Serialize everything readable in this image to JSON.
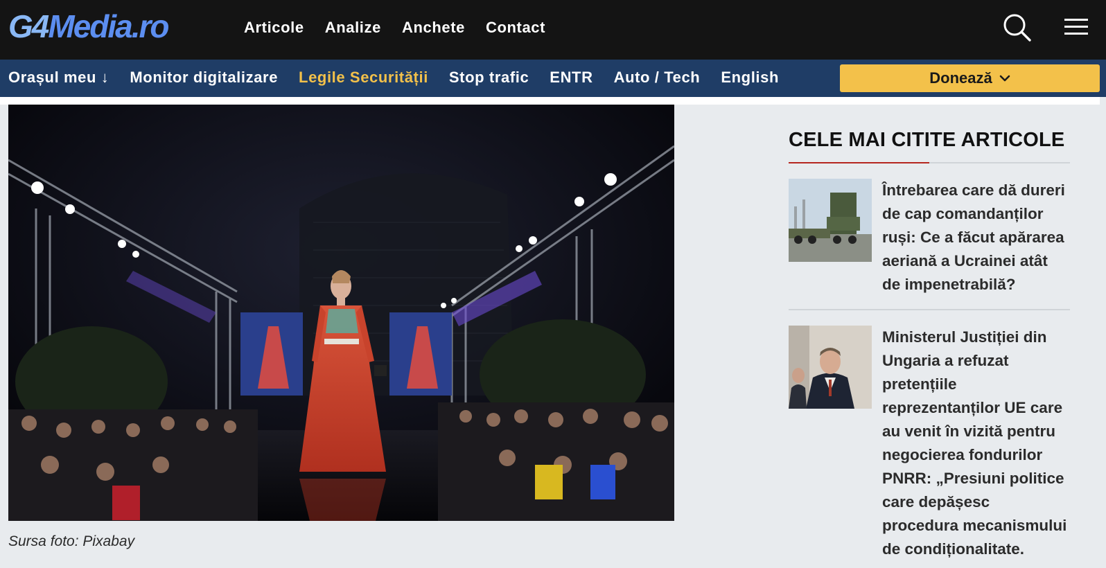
{
  "header": {
    "logo_prefix": "G4",
    "logo_main": "Media.ro",
    "nav": [
      "Articole",
      "Analize",
      "Anchete",
      "Contact"
    ],
    "search_icon": "search-icon",
    "menu_icon": "hamburger-menu-icon"
  },
  "subnav": {
    "items": [
      {
        "label": "Orașul meu ↓"
      },
      {
        "label": "Monitor digitalizare"
      },
      {
        "label": "Legile Securității"
      },
      {
        "label": "Stop trafic"
      },
      {
        "label": "ENTR"
      },
      {
        "label": "Auto / Tech"
      },
      {
        "label": "English"
      }
    ],
    "donate_label": "Donează",
    "accent_color": "#f3c14a",
    "bar_color": "#1f3d66"
  },
  "hero": {
    "caption": "Sursa foto: Pixabay"
  },
  "sidebar": {
    "title": "CELE MAI CITITE ARTICOLE",
    "accent_color": "#b5261e",
    "articles": [
      {
        "title": "Întrebarea care dă dureri de cap comandanților ruși: Ce a făcut apărarea aeriană a Ucrainei atât de impenetrabilă?"
      },
      {
        "title": "Ministerul Justiției din Ungaria a refuzat pretențiile reprezentanților UE care au venit în vizită pentru negocierea fondurilor PNRR: „Presiuni politice care depășesc procedura mecanismului de condiționalitate."
      }
    ]
  }
}
